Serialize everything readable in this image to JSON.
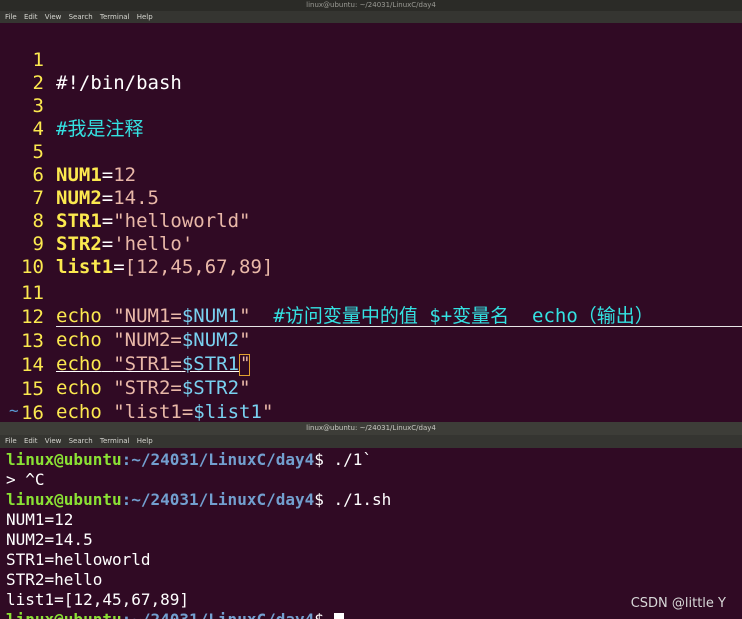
{
  "editor_window": {
    "title": "linux@ubuntu: ~/24031/LinuxC/day4",
    "menu": [
      "File",
      "Edit",
      "View",
      "Search",
      "Terminal",
      "Help"
    ],
    "lines": [
      {
        "n": "1",
        "code": "#!/bin/bash"
      },
      {
        "n": "2",
        "code": ""
      },
      {
        "n": "3",
        "code": "#我是注释"
      },
      {
        "n": "4",
        "code": ""
      },
      {
        "n": "5",
        "name": "NUM1",
        "eq": "=",
        "value": "12"
      },
      {
        "n": "6",
        "name": "NUM2",
        "eq": "=",
        "value": "14.5"
      },
      {
        "n": "7",
        "name": "STR1",
        "eq": "=",
        "value": "\"helloworld\""
      },
      {
        "n": "8",
        "name": "STR2",
        "eq": "=",
        "value": "'hello'"
      },
      {
        "n": "9",
        "name": "list1",
        "eq": "=",
        "value": "[12,45,67,89]"
      },
      {
        "n": "10",
        "code": ""
      },
      {
        "n": "11",
        "cmd": "echo",
        "str_open": "\"NUM1=",
        "var": "$NUM1",
        "str_close": "\"",
        "comment": "  #访问变量中的值 $+变量名  echo（输出）"
      },
      {
        "n": "12",
        "cmd": "echo",
        "str_open": "\"NUM2=",
        "var": "$NUM2",
        "str_close": "\""
      },
      {
        "n": "13",
        "cmd": "echo",
        "str_open": "\"STR1=",
        "var": "$STR1",
        "str_close": "\""
      },
      {
        "n": "14",
        "cmd": "echo",
        "str_open": "\"STR2=",
        "var": "$STR2",
        "str_close": "\""
      },
      {
        "n": "15",
        "cmd": "echo",
        "str_open": "\"list1=",
        "var": "$list1",
        "str_close": "\""
      },
      {
        "n": "16",
        "code": ""
      }
    ],
    "tilde": "~"
  },
  "terminal_window": {
    "title": "linux@ubuntu: ~/24031/LinuxC/day4",
    "menu": [
      "File",
      "Edit",
      "View",
      "Search",
      "Terminal",
      "Help"
    ],
    "prompt_user": "linux@ubuntu",
    "prompt_path": ":~/24031/LinuxC/day4",
    "prompt_end": "$ ",
    "cmd1": "./1`",
    "line2": "> ^C",
    "cmd2": "./1.sh",
    "outputs": [
      "NUM1=12",
      "NUM2=14.5",
      "STR1=helloworld",
      "STR2=hello",
      "list1=[12,45,67,89]"
    ]
  },
  "watermark": "CSDN @little Y"
}
